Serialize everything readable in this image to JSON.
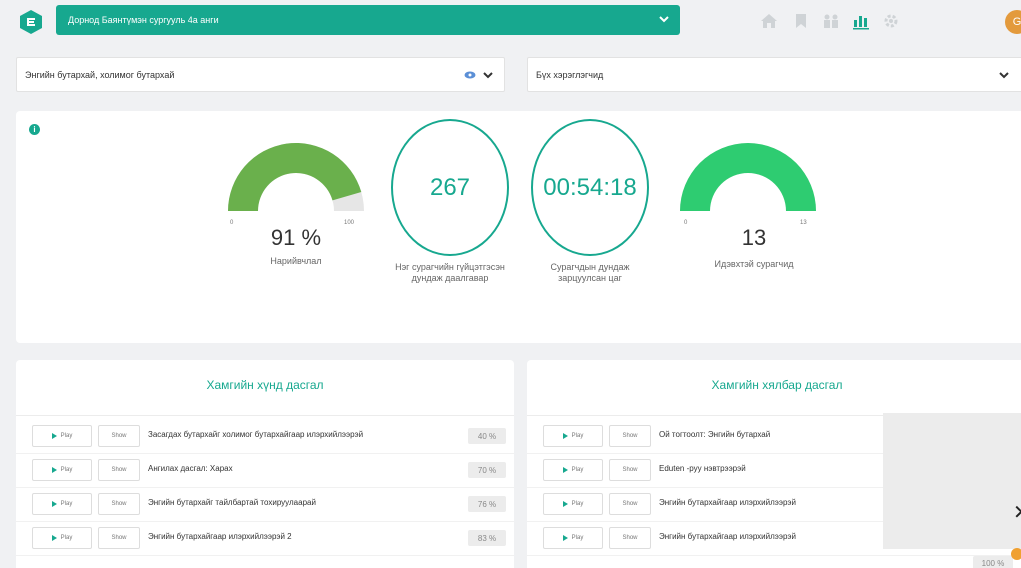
{
  "header": {
    "class_select": "Дорнод Баянтүмэн сургууль 4а анги",
    "avatar_letter": "G"
  },
  "filters": {
    "left": "Энгийн бутархай, холимог бутархай",
    "right": "Бүх хэрэглэгчид"
  },
  "stats": {
    "accuracy": {
      "value": "91 %",
      "fraction": 0.91,
      "min": "0",
      "max": "100",
      "label": "Нарийвчлал"
    },
    "avg_tasks": {
      "value": "267",
      "label": "Нэг сурагчийн гүйцэтгэсэн дундаж даалгавар"
    },
    "avg_time": {
      "value": "00:54:18",
      "label": "Сурагчдын дундаж зарцуулсан цаг"
    },
    "active": {
      "value": "13",
      "fraction": 1.0,
      "min": "0",
      "max": "13",
      "label": "Идэвхтэй сурагчид"
    }
  },
  "hardest": {
    "title": "Хамгийн хүнд дасгал",
    "rows": [
      {
        "play": "Play",
        "show": "Show",
        "name": "Засагдах бутархайг холимог бутархайгаар илэрхийлээрэй",
        "pct": "40 %"
      },
      {
        "play": "Play",
        "show": "Show",
        "name": "Ангилах дасгал: Харах",
        "pct": "70 %"
      },
      {
        "play": "Play",
        "show": "Show",
        "name": "Энгийн бутархайг тайлбартай тохируулаарай",
        "pct": "76 %"
      },
      {
        "play": "Play",
        "show": "Show",
        "name": "Энгийн бутархайгаар илэрхийлээрэй 2",
        "pct": "83 %"
      }
    ]
  },
  "easiest": {
    "title": "Хамгийн хялбар дасгал",
    "rows": [
      {
        "play": "Play",
        "show": "Show",
        "name": "Ой тогтоолт: Энгийн бутархай",
        "pct": ""
      },
      {
        "play": "Play",
        "show": "Show",
        "name": "Eduten -руу нэвтрээрэй",
        "pct": ""
      },
      {
        "play": "Play",
        "show": "Show",
        "name": "Энгийн бутархайгаар илэрхийлээрэй",
        "pct": ""
      },
      {
        "play": "Play",
        "show": "Show",
        "name": "Энгийн бутархайгаар илэрхийлээрэй",
        "pct": "100 %"
      }
    ]
  },
  "colors": {
    "accent": "#17a88f",
    "gauge_green": "#6ab04c",
    "gauge_bright": "#2ecc71"
  }
}
